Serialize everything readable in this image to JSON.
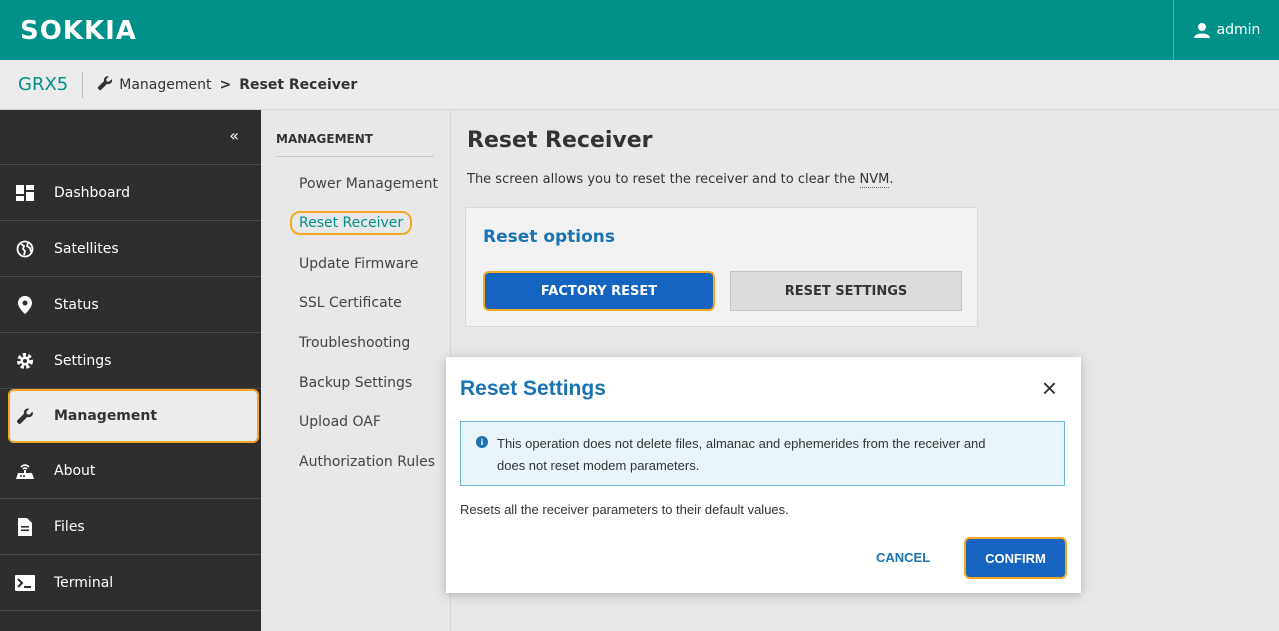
{
  "header": {
    "logo": "SOKKIA",
    "user": "admin",
    "user_icon": "user-icon",
    "color": "#00908a"
  },
  "breadcrumb": {
    "device": "GRX5",
    "section_icon": "wrench-icon",
    "section": "Management",
    "separator": ">",
    "current": "Reset Receiver"
  },
  "sidebar": {
    "collapse_label": "«",
    "items": [
      {
        "label": "Dashboard",
        "icon": "dashboard-icon"
      },
      {
        "label": "Satellites",
        "icon": "globe-icon"
      },
      {
        "label": "Status",
        "icon": "location-pin-icon"
      },
      {
        "label": "Settings",
        "icon": "gear-icon"
      },
      {
        "label": "Management",
        "icon": "wrench-icon",
        "active": true
      },
      {
        "label": "About",
        "icon": "receiver-icon"
      },
      {
        "label": "Files",
        "icon": "file-icon"
      },
      {
        "label": "Terminal",
        "icon": "terminal-icon"
      }
    ]
  },
  "submenu": {
    "heading": "MANAGEMENT",
    "items": [
      {
        "label": "Power Management"
      },
      {
        "label": "Reset Receiver",
        "active": true
      },
      {
        "label": "Update Firmware"
      },
      {
        "label": "SSL Certificate"
      },
      {
        "label": "Troubleshooting"
      },
      {
        "label": "Backup Settings"
      },
      {
        "label": "Upload OAF"
      },
      {
        "label": "Authorization Rules"
      }
    ]
  },
  "main": {
    "title": "Reset Receiver",
    "description_prefix": "The screen allows you to reset the receiver and to clear the ",
    "description_abbr": "NVM",
    "description_suffix": ".",
    "card_title": "Reset options",
    "factory_reset": "FACTORY RESET",
    "reset_settings": "RESET SETTINGS"
  },
  "modal": {
    "title": "Reset Settings",
    "close": "×",
    "alert_icon": "info-icon",
    "alert_line1": "This operation does not delete files, almanac and ephemerides from the receiver and",
    "alert_line2": "does not reset modem parameters.",
    "description": "Resets all the receiver parameters to their default values.",
    "cancel": "CANCEL",
    "confirm": "CONFIRM"
  }
}
